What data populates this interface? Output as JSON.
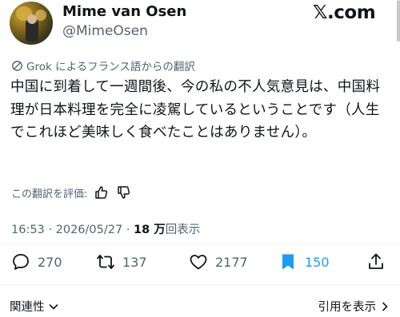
{
  "author": {
    "display_name": "Mime van Osen",
    "handle": "@MimeOsen"
  },
  "brand": "𝕏.com",
  "translation_note": "Grok によるフランス語からの翻訳",
  "tweet_text": "中国に到着して一週間後、今の私の不人気意見は、中国料理が日本料理を完全に凌駕しているということです（人生でこれほど美味しく食べたことはありません）。",
  "rate_translation": "この翻訳を評価:",
  "meta": {
    "time": "16:53",
    "separator": "·",
    "date": "2026/05/27",
    "views_count": "18 万",
    "views_label": "回表示"
  },
  "actions": {
    "replies": "270",
    "retweets": "137",
    "likes": "2177",
    "bookmarks": "150"
  },
  "footer": {
    "related": "関連性",
    "quotes": "引用を表示"
  },
  "colors": {
    "accent": "#1d9bf0",
    "text": "#0f1419",
    "secondary": "#536471"
  }
}
